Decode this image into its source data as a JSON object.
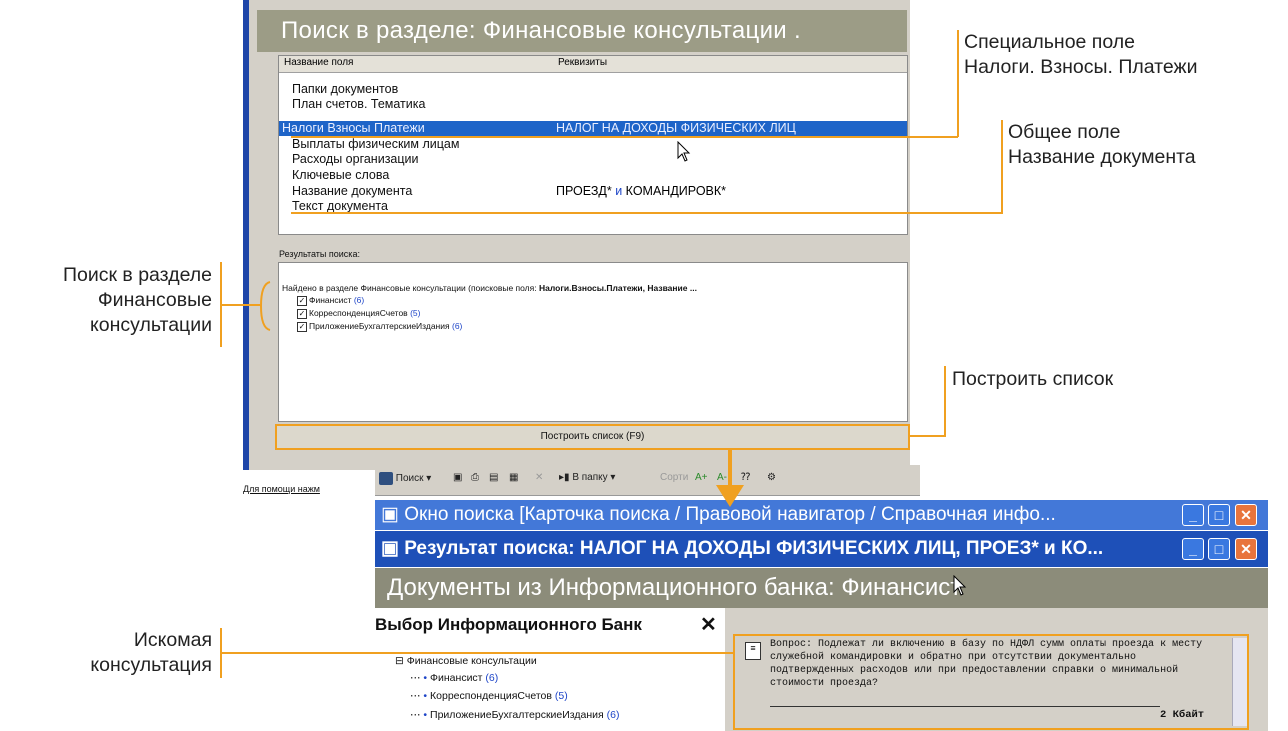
{
  "search_window": {
    "title": "Поиск в разделе: Финансовые консультации .",
    "col_field": "Название поля",
    "col_requisites": "Реквизиты",
    "fields": [
      "Папки документов",
      "План счетов. Тематика",
      "Налоги Взносы Платежи",
      "Выплаты физическим лицам",
      "Расходы организации",
      "Ключевые слова",
      "Название документа",
      "Текст документа"
    ],
    "selected_value": "НАЛОГ НА ДОХОДЫ ФИЗИЧЕСКИХ ЛИЦ",
    "docname_value_a": "ПРОЕЗД*",
    "docname_and": "и",
    "docname_value_b": "КОМАНДИРОВК*",
    "results_label": "Результаты поиска:",
    "found_prefix": "Найдено в разделе Финансовые консультации (поисковые поля:",
    "found_fields": "Налоги.Взносы.Платежи, Название ...",
    "found_items": [
      {
        "label": "Финансист",
        "count": "(6)"
      },
      {
        "label": "КорреспонденцияСчетов",
        "count": "(5)"
      },
      {
        "label": "ПриложениеБухгалтерскиеИздания",
        "count": "(6)"
      }
    ],
    "build_button": "Построить список (F9)",
    "status": "Для помощи нажм"
  },
  "toolbar": {
    "search": "Поиск",
    "to_folder": "В папку",
    "sort": "Сорти"
  },
  "window_search": {
    "title": "Окно поиска [Карточка поиска / Правовой навигатор / Справочная инфо..."
  },
  "window_result": {
    "title": "Результат поиска: НАЛОГ НА ДОХОДЫ ФИЗИЧЕСКИХ ЛИЦ, ПРОЕЗ* и КО..."
  },
  "docs": {
    "title": "Документы из Информационного банка: Финансист",
    "bank_header": "Выбор Информационного Банк",
    "tree_root": "Финансовые консультации",
    "tree_items": [
      {
        "label": "Финансист",
        "count": "(6)"
      },
      {
        "label": "КорреспонденцияСчетов",
        "count": "(5)"
      },
      {
        "label": "ПриложениеБухгалтерскиеИздания",
        "count": "(6)"
      }
    ],
    "doc_text": "Вопрос: Подлежат ли включению в базу по НДФЛ сумм оплаты проезда к месту служебной командировки и обратно при отсутствии документально подтвержденных расходов или при предоставлении справки о минимальной стоимости проезда?",
    "doc_size": "2 Кбайт"
  },
  "annotations": {
    "special_field_1": "Специальное поле",
    "special_field_2": "Налоги. Взносы. Платежи",
    "general_field_1": "Общее поле",
    "general_field_2": "Название документа",
    "search_section_1": "Поиск в разделе",
    "search_section_2": "Финансовые",
    "search_section_3": "консультации",
    "build_list": "Построить список",
    "target_1": "Искомая",
    "target_2": "консультация"
  },
  "colors": {
    "accent_orange": "#f0a020",
    "selection_blue": "#1e64c8",
    "window_title_blue": "#1e50b8"
  }
}
